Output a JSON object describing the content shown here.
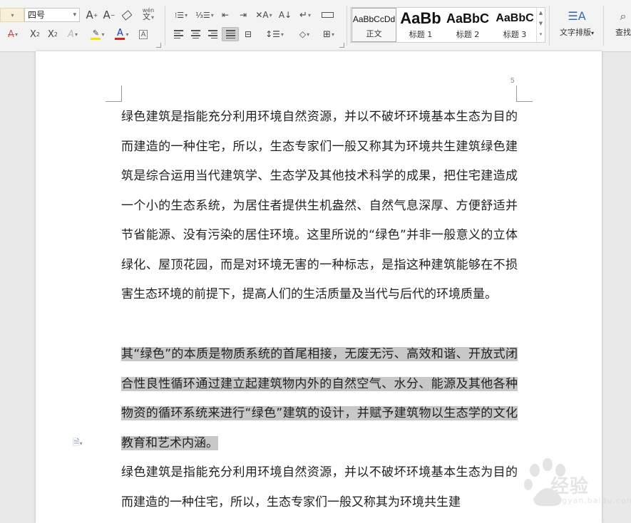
{
  "toolbar": {
    "font_size": "四号",
    "phonetic_label": "wén",
    "styles": [
      {
        "sample": "AaBbCcDd",
        "name": "正文"
      },
      {
        "sample": "AaBb",
        "name": "标题 1"
      },
      {
        "sample": "AaBbC",
        "name": "标题 2"
      },
      {
        "sample": "AaBbC",
        "name": "标题 3"
      }
    ],
    "text_layout_label": "文字排版",
    "find_label": "查找"
  },
  "document": {
    "page_number": "5",
    "paragraph1": "绿色建筑是指能充分利用环境自然资源，并以不破坏环境基本生态为目的而建造的一种住宅，所以，生态专家们一般又称其为环境共生建筑绿色建筑是综合运用当代建筑学、生态学及其他技术科学的成果，把住宅建造成一个小的生态系统，为居住者提供生机盎然、自然气息深厚、方便舒适并节省能源、没有污染的居住环境。这里所说的“绿色”并非一般意义的立体绿化、屋顶花园，而是对环境无害的一种标志，是指这种建筑能够在不损害生态环境的前提下，提高人们的生活质量及当代与后代的环境质量。",
    "paragraph2": "其“绿色”的本质是物质系统的首尾相接，无废无污、高效和谐、开放式闭合性良性循环通过建立起建筑物内外的自然空气、水分、能源及其他各种物资的循环系统来进行“绿色”建筑的设计，并赋予建筑物以生态学的文化教育和艺术内涵。",
    "paragraph3": "绿色建筑是指能充分利用环境自然资源，并以不破坏环境基本生态为目的而建造的一种住宅，所以，生态专家们一般又称其为环境共生建"
  },
  "watermark": {
    "text": "经验",
    "sub": "jingyan.baidu.com"
  },
  "colors": {
    "highlight": "#c8c8c8",
    "font_color_bar": "#e02020",
    "highlight_color_bar": "#f5e000",
    "text_color": "#222222"
  }
}
